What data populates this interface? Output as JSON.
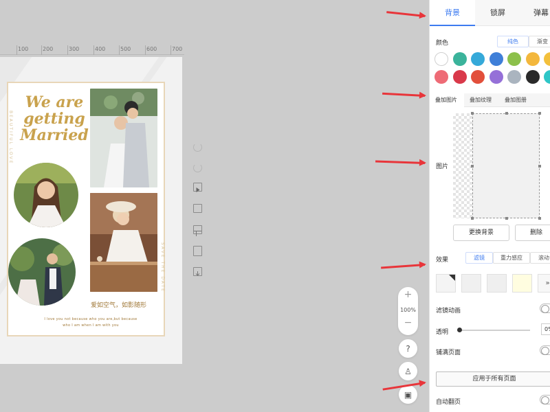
{
  "ruler": {
    "ticks": [
      "100",
      "200",
      "300",
      "400",
      "500",
      "600",
      "700"
    ]
  },
  "card": {
    "title": "We are getting Married",
    "left_vertical": "BEAUTIFUL LOVE",
    "right_vertical": "SAVE THE DATE",
    "caption": "爱如空气，如影随形",
    "line1": "I love you not because who you are,but because",
    "line2": "who I am when I am with you"
  },
  "zoom": {
    "plus": "+",
    "value": "100%",
    "minus": "−"
  },
  "circle_buttons": {
    "help": "?",
    "user": "♙",
    "image": "▣"
  },
  "panel": {
    "tabs": [
      {
        "label": "背景"
      },
      {
        "label": "锁屏"
      },
      {
        "label": "弹幕"
      }
    ],
    "color": {
      "label": "颜色",
      "modes": [
        {
          "label": "纯色"
        },
        {
          "label": "渐变"
        }
      ],
      "swatches_row1": [
        "#ffffff",
        "#3bb39b",
        "#35a9d9",
        "#3f7fd8",
        "#8cc04b",
        "#f3b73c",
        "#f3c03c"
      ],
      "swatches_row2": [
        "#ee6b76",
        "#d9394a",
        "#e24f3b",
        "#9570d8",
        "#aab4bf",
        "#2a2a2a",
        "#2ec6c7"
      ]
    },
    "overlay_tabs": [
      {
        "label": "叠加图片"
      },
      {
        "label": "叠加纹理"
      },
      {
        "label": "叠加图册"
      }
    ],
    "image": {
      "label": "图片",
      "replace_button": "更换背景",
      "delete_button": "删除"
    },
    "effect": {
      "label": "效果",
      "modes": [
        {
          "label": "滤镜"
        },
        {
          "label": "重力感应"
        },
        {
          "label": "滚动"
        }
      ],
      "more": "»"
    },
    "filter_anim": {
      "label": "滤镜动画"
    },
    "opacity": {
      "label": "透明",
      "value": "0%",
      "level": 0
    },
    "fill_page": {
      "label": "铺满页面"
    },
    "apply_all": "应用于所有页面",
    "auto_flip": {
      "label": "自动翻页"
    }
  }
}
